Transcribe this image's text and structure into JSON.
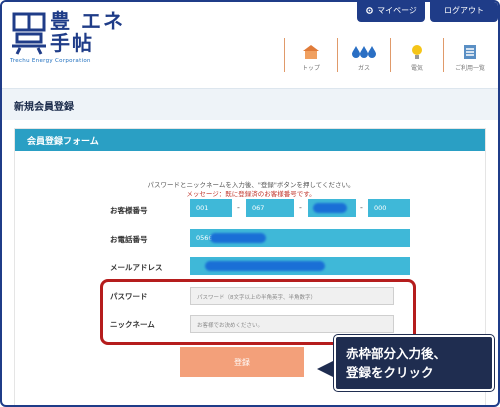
{
  "header": {
    "logo_line1": "豊 エネ",
    "logo_line2": "手帖",
    "logo_sub": "Trechu Energy Corporation",
    "mypage_label": "マイページ",
    "logout_label": "ログアウト",
    "nav": [
      {
        "label": "トップ",
        "icon": "house-icon"
      },
      {
        "label": "ガス",
        "icon": "gas-drops-icon"
      },
      {
        "label": "電気",
        "icon": "lightbulb-icon"
      },
      {
        "label": "ご利用一覧",
        "icon": "list-icon"
      }
    ]
  },
  "page": {
    "title": "新規会員登録"
  },
  "form": {
    "heading": "会員登録フォーム",
    "notice": "パスワードとニックネームを入力後、\"登録\"ボタンを押してください。",
    "error": "メッセージ：既に登録済のお客様番号です。",
    "customer_number_label": "お客様番号",
    "customer_number_parts": [
      "001",
      "067",
      "",
      "000"
    ],
    "phone_label": "お電話番号",
    "phone_value": "0566",
    "email_label": "メールアドレス",
    "password_label": "パスワード",
    "password_placeholder": "パスワード（8文字以上の半角英字、半角数字）",
    "nickname_label": "ニックネーム",
    "nickname_placeholder": "お客様でお決めください。",
    "register_label": "登録"
  },
  "callout": {
    "line1": "赤枠部分入力後、",
    "line2": "登録をクリック"
  },
  "colors": {
    "brand_navy": "#1f3c88",
    "form_header": "#2a9fc4",
    "field_teal": "#3fb8d8",
    "register_button": "#f3a07a",
    "highlight_red": "#b51d1d",
    "error_red": "#c0342a"
  }
}
